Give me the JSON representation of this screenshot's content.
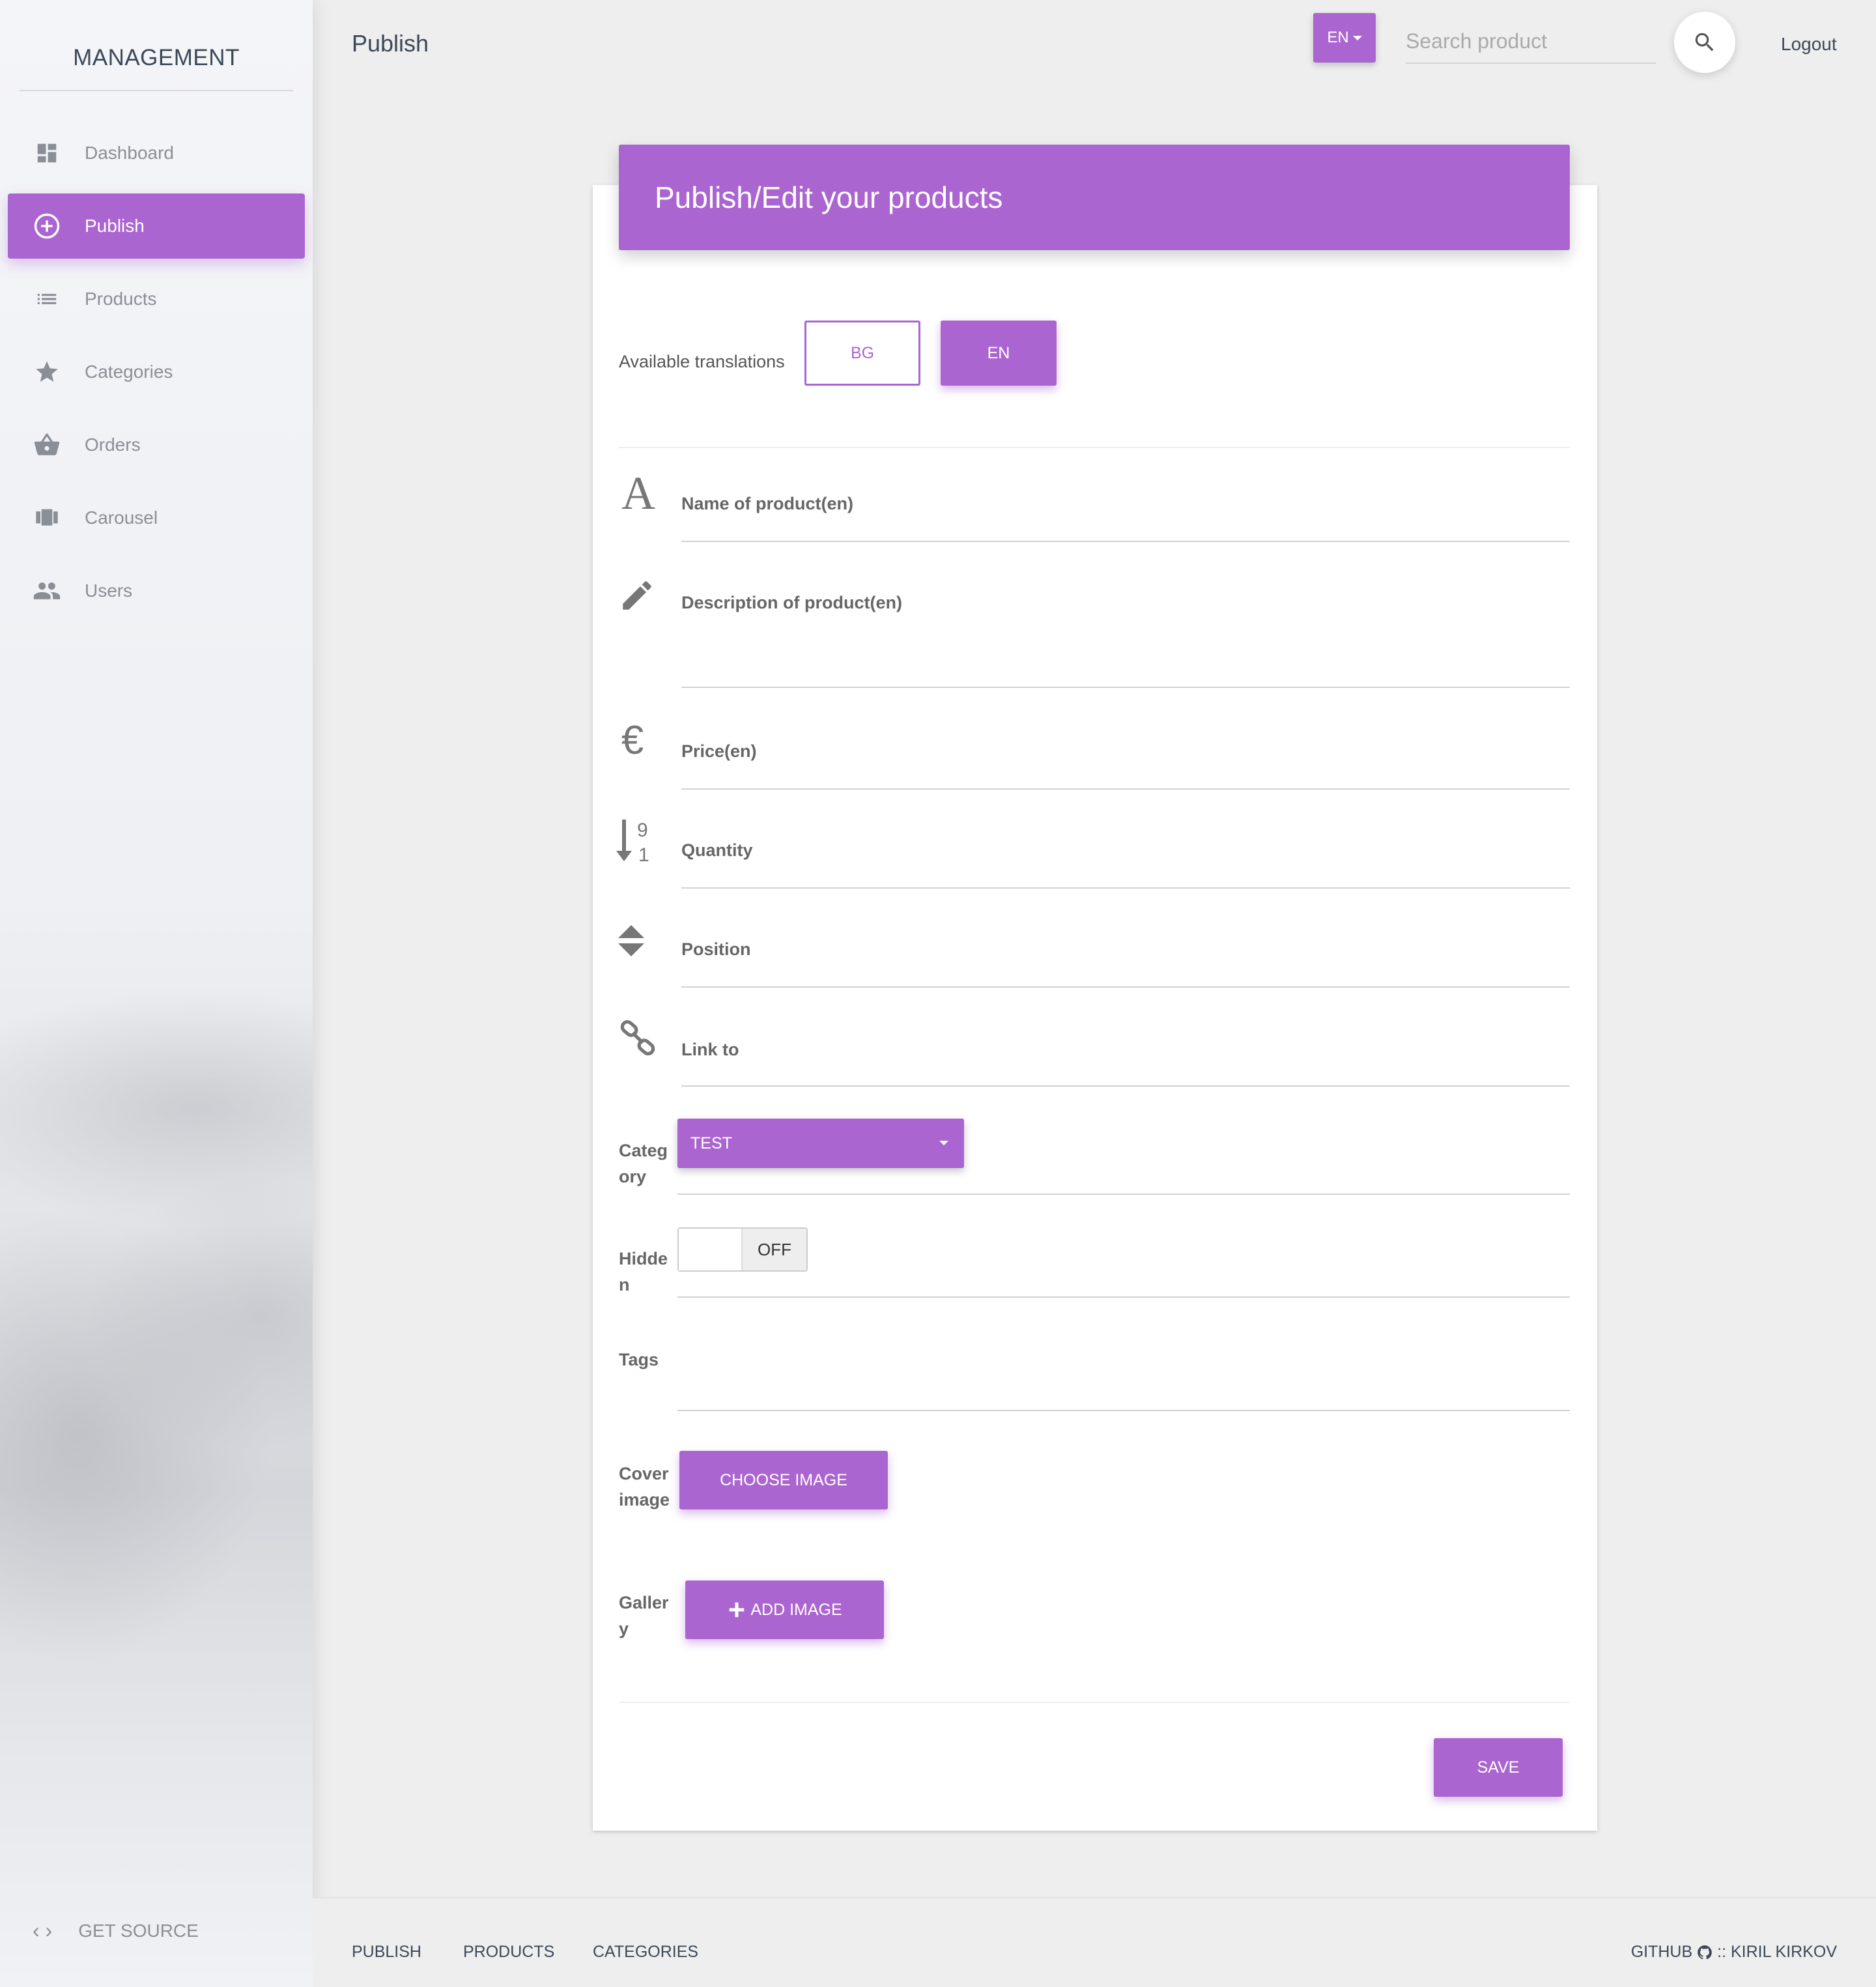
{
  "sidebar": {
    "brand": "MANAGEMENT",
    "items": [
      {
        "label": "Dashboard",
        "icon": "dashboard-icon"
      },
      {
        "label": "Publish",
        "icon": "add-circle-icon",
        "active": true
      },
      {
        "label": "Products",
        "icon": "list-icon"
      },
      {
        "label": "Categories",
        "icon": "star-icon"
      },
      {
        "label": "Orders",
        "icon": "basket-icon"
      },
      {
        "label": "Carousel",
        "icon": "carousel-icon"
      },
      {
        "label": "Users",
        "icon": "users-icon"
      }
    ],
    "get_source": "GET SOURCE"
  },
  "topbar": {
    "title": "Publish",
    "language": "EN",
    "search_placeholder": "Search product",
    "logout": "Logout"
  },
  "card": {
    "title": "Publish/Edit your products",
    "translations_label": "Available translations",
    "translations": [
      "BG",
      "EN"
    ],
    "fields": {
      "name": "Name of product(en)",
      "description": "Description of product(en)",
      "price": "Price(en)",
      "quantity": "Quantity",
      "position": "Position",
      "link": "Link to",
      "category_line1": "Categ",
      "category_line2": "ory",
      "category_value": "TEST",
      "hidden_line1": "Hidde",
      "hidden_line2": "n",
      "hidden_state": "OFF",
      "tags": "Tags",
      "cover_line1": "Cover",
      "cover_line2": "image",
      "choose_image": "CHOOSE IMAGE",
      "gallery_line1": "Galler",
      "gallery_line2": "y",
      "add_image": "ADD IMAGE"
    },
    "save": "SAVE"
  },
  "footer": {
    "links": [
      "PUBLISH",
      "PRODUCTS",
      "CATEGORIES"
    ],
    "github": "GITHUB",
    "author": ":: KIRIL KIRKOV"
  },
  "colors": {
    "accent": "#ab65d0",
    "background": "#eeeeee",
    "text": "#3c4858"
  }
}
